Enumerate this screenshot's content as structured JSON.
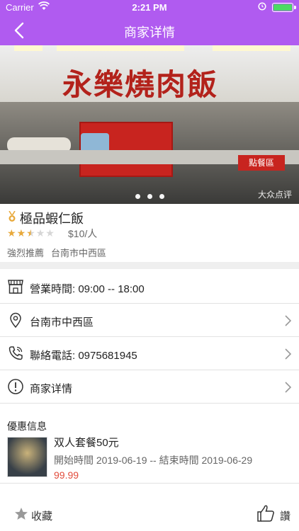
{
  "status_bar": {
    "carrier": "Carrier",
    "time": "2:21 PM"
  },
  "nav": {
    "title": "商家详情"
  },
  "banner": {
    "sign_text": "永樂燒肉飯",
    "order_sign": "點餐區",
    "watermark": "大众点评",
    "pager_dots": 3
  },
  "shop": {
    "name": "極品蝦仁飯",
    "rating": 2.5,
    "rating_max": 5,
    "price": "$10/人",
    "tags": [
      "強烈推薦",
      "台南市中西區"
    ]
  },
  "info_rows": [
    {
      "icon": "shop-icon",
      "text": "營業時間: 09:00 -- 18:00"
    },
    {
      "icon": "location-icon",
      "text": "台南市中西區"
    },
    {
      "icon": "phone-icon",
      "text": "聯絡電話: 0975681945"
    },
    {
      "icon": "info-icon",
      "text": "商家详情"
    }
  ],
  "deals": {
    "title": "優惠信息",
    "items": [
      {
        "name": "双人套餐50元",
        "time": "開始時間 2019-06-19 -- 結束時間 2019-06-29",
        "price": "99.99"
      }
    ]
  },
  "bottom_bar": {
    "favorite_label": "收藏",
    "like_label": "讚"
  },
  "colors": {
    "header": "#b05bf0",
    "star_active": "#e8a93b",
    "price_red": "#e24c3c"
  }
}
